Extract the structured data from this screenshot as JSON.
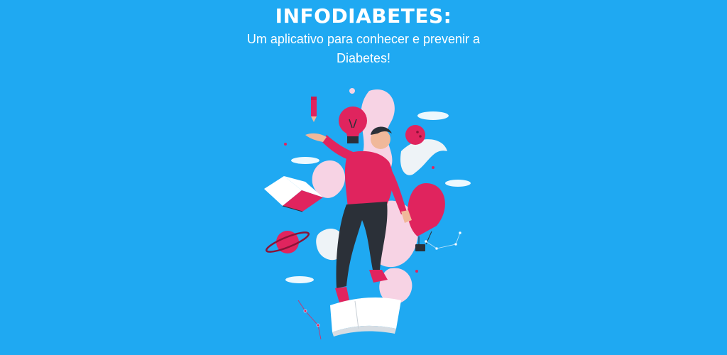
{
  "header": {
    "title": "INFODIABETES:",
    "subtitle": "Um aplicativo para conhecer e prevenir a Diabetes!"
  },
  "colors": {
    "background": "#1fa9f2",
    "accent": "#e0245e",
    "text": "#ffffff",
    "pants": "#2b3038",
    "skin": "#f0b89a"
  },
  "illustration": {
    "icons": [
      "pencil-icon",
      "lightbulb-icon",
      "ball-icon",
      "book-icon",
      "planet-icon",
      "hot-air-balloon-icon",
      "notebook-icon"
    ]
  }
}
